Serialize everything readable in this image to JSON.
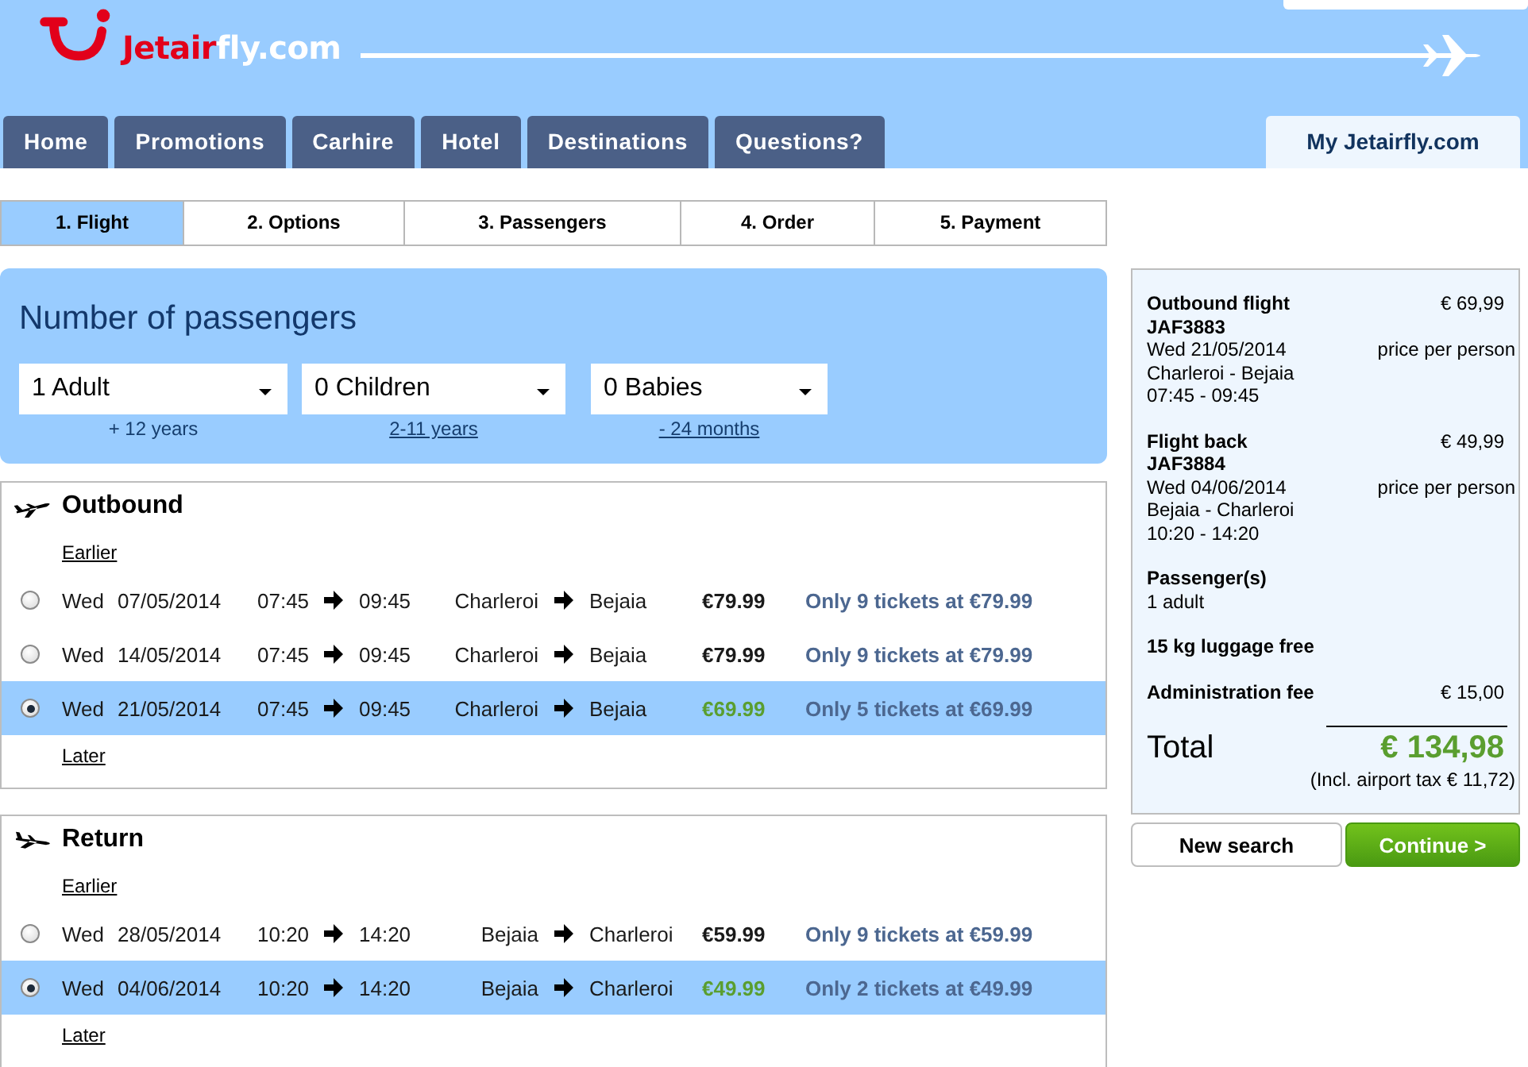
{
  "header": {
    "logo": {
      "brand": "Jetair",
      "suffix": "fly.com"
    },
    "nav": [
      "Home",
      "Promotions",
      "Carhire",
      "Hotel",
      "Destinations",
      "Questions?"
    ],
    "account_tab": "My Jetairfly.com"
  },
  "steps": [
    {
      "label": "1. Flight",
      "selected": true
    },
    {
      "label": "2. Options",
      "selected": false
    },
    {
      "label": "3. Passengers",
      "selected": false
    },
    {
      "label": "4. Order",
      "selected": false
    },
    {
      "label": "5. Payment",
      "selected": false
    }
  ],
  "passengers": {
    "title": "Number of passengers",
    "selects": [
      {
        "value": "1 Adult",
        "hint": "+ 12 years",
        "hint_link": false
      },
      {
        "value": "0 Children",
        "hint": "2-11 years",
        "hint_link": true
      },
      {
        "value": "0 Babies",
        "hint": "- 24 months",
        "hint_link": true
      }
    ]
  },
  "flights": [
    {
      "kind": "outbound",
      "title": "Outbound",
      "earlier": "Earlier",
      "later": "Later",
      "rows": [
        {
          "day": "Wed",
          "date": "07/05/2014",
          "depart": "07:45",
          "arrive": "09:45",
          "from": "Charleroi",
          "to": "Bejaia",
          "price": "€79.99",
          "offer": "Only 9 tickets at €79.99",
          "selected": false
        },
        {
          "day": "Wed",
          "date": "14/05/2014",
          "depart": "07:45",
          "arrive": "09:45",
          "from": "Charleroi",
          "to": "Bejaia",
          "price": "€79.99",
          "offer": "Only 9 tickets at €79.99",
          "selected": false
        },
        {
          "day": "Wed",
          "date": "21/05/2014",
          "depart": "07:45",
          "arrive": "09:45",
          "from": "Charleroi",
          "to": "Bejaia",
          "price": "€69.99",
          "offer": "Only 5 tickets at €69.99",
          "selected": true
        }
      ]
    },
    {
      "kind": "return",
      "title": "Return",
      "earlier": "Earlier",
      "later": "Later",
      "rows": [
        {
          "day": "Wed",
          "date": "28/05/2014",
          "depart": "10:20",
          "arrive": "14:20",
          "from": "Bejaia",
          "to": "Charleroi",
          "price": "€59.99",
          "offer": "Only 9 tickets at €59.99",
          "selected": false
        },
        {
          "day": "Wed",
          "date": "04/06/2014",
          "depart": "10:20",
          "arrive": "14:20",
          "from": "Bejaia",
          "to": "Charleroi",
          "price": "€49.99",
          "offer": "Only 2 tickets at €49.99",
          "selected": true
        }
      ]
    }
  ],
  "summary": {
    "legs": [
      {
        "title": "Outbound flight",
        "price": "€ 69,99",
        "code": "JAF3883",
        "date": "Wed 21/05/2014",
        "price_note": "price per person",
        "route": "Charleroi - Bejaia",
        "times": "07:45 - 09:45"
      },
      {
        "title": "Flight back",
        "price": "€ 49,99",
        "code": "JAF3884",
        "date": "Wed 04/06/2014",
        "price_note": "price per person",
        "route": "Bejaia - Charleroi",
        "times": "10:20 - 14:20"
      }
    ],
    "passengers_label": "Passenger(s)",
    "passengers_value": "1 adult",
    "luggage": "15 kg luggage free",
    "fee": {
      "label": "Administration fee",
      "amount": "€ 15,00"
    },
    "total": {
      "label": "Total",
      "amount": "€ 134,98",
      "note": "(Incl. airport tax € 11,72)"
    }
  },
  "actions": [
    {
      "label": "New search",
      "kind": "secondary"
    },
    {
      "label": "Continue >",
      "kind": "primary"
    }
  ]
}
